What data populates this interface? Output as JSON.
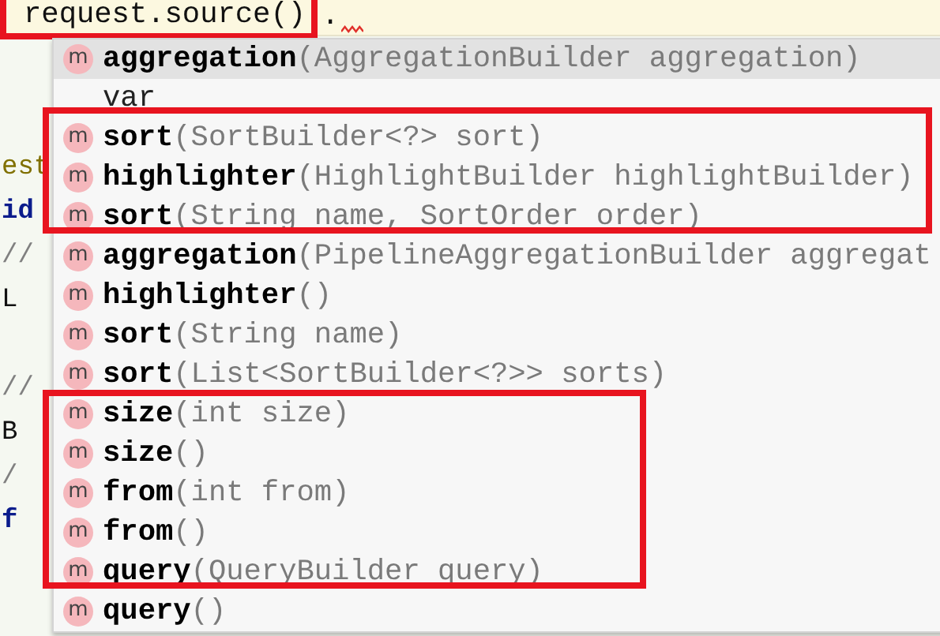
{
  "current_line": {
    "code": "request.source()",
    "trailing": "."
  },
  "code_lines": [
    {
      "kind": "method",
      "text": "est"
    },
    {
      "kind": "keyword",
      "text": "id"
    },
    {
      "kind": "comment",
      "text": "//"
    },
    {
      "kind": "plain",
      "text": "L"
    },
    {
      "kind": "blank"
    },
    {
      "kind": "comment",
      "text": "//"
    },
    {
      "kind": "plain",
      "text": "B"
    },
    {
      "kind": "comment",
      "text": "/"
    },
    {
      "kind": "keyword",
      "text": "f"
    }
  ],
  "completions": [
    {
      "kind": "method",
      "icon": "m",
      "name": "aggregation",
      "params": "(AggregationBuilder aggregation)",
      "selected": true
    },
    {
      "kind": "template",
      "name": "var",
      "selected": false
    },
    {
      "kind": "method",
      "icon": "m",
      "name": "sort",
      "params": "(SortBuilder<?> sort)",
      "selected": false
    },
    {
      "kind": "method",
      "icon": "m",
      "name": "highlighter",
      "params": "(HighlightBuilder highlightBuilder)",
      "selected": false
    },
    {
      "kind": "method",
      "icon": "m",
      "name": "sort",
      "params": "(String name, SortOrder order)",
      "selected": false
    },
    {
      "kind": "method",
      "icon": "m",
      "name": "aggregation",
      "params": "(PipelineAggregationBuilder aggregat",
      "selected": false
    },
    {
      "kind": "method",
      "icon": "m",
      "name": "highlighter",
      "params": "()",
      "selected": false
    },
    {
      "kind": "method",
      "icon": "m",
      "name": "sort",
      "params": "(String name)",
      "selected": false
    },
    {
      "kind": "method",
      "icon": "m",
      "name": "sort",
      "params": "(List<SortBuilder<?>> sorts)",
      "selected": false
    },
    {
      "kind": "method",
      "icon": "m",
      "name": "size",
      "params": "(int size)",
      "selected": false
    },
    {
      "kind": "method",
      "icon": "m",
      "name": "size",
      "params": "()",
      "selected": false
    },
    {
      "kind": "method",
      "icon": "m",
      "name": "from",
      "params": "(int from)",
      "selected": false
    },
    {
      "kind": "method",
      "icon": "m",
      "name": "from",
      "params": "()",
      "selected": false
    },
    {
      "kind": "method",
      "icon": "m",
      "name": "query",
      "params": "(QueryBuilder query)",
      "selected": false
    },
    {
      "kind": "method",
      "icon": "m",
      "name": "query",
      "params": "()",
      "selected": false
    }
  ]
}
